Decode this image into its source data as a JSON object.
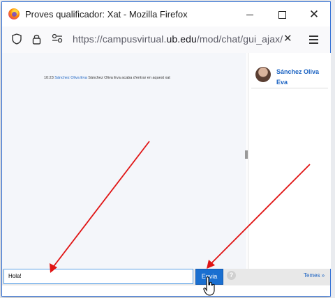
{
  "window": {
    "title": "Proves qualificador: Xat - Mozilla Firefox",
    "controls": [
      "minimize-icon",
      "maximize-icon",
      "close-icon"
    ]
  },
  "navbar": {
    "url_prefix": "https://campusvirtual.",
    "url_host": "ub.edu",
    "url_path": "/mod/chat/gui_ajax/",
    "icons": [
      "shield-icon",
      "lock-icon",
      "permissions-icon",
      "close-icon",
      "menu-icon"
    ]
  },
  "chat": {
    "message": {
      "time": "10:23",
      "user": "Sánchez Oliva Eva",
      "text": "Sánchez Oliva Eva acaba d'entrar en aquest xat"
    },
    "users": [
      {
        "name": "Sánchez Oliva Eva"
      }
    ],
    "input_value": "Hola!",
    "send_label": "Envia",
    "help_label": "?",
    "themes_label": "Temes »"
  },
  "colors": {
    "link": "#1a62c2",
    "button": "#1a6fd0",
    "annotation_arrow": "#e01414"
  }
}
